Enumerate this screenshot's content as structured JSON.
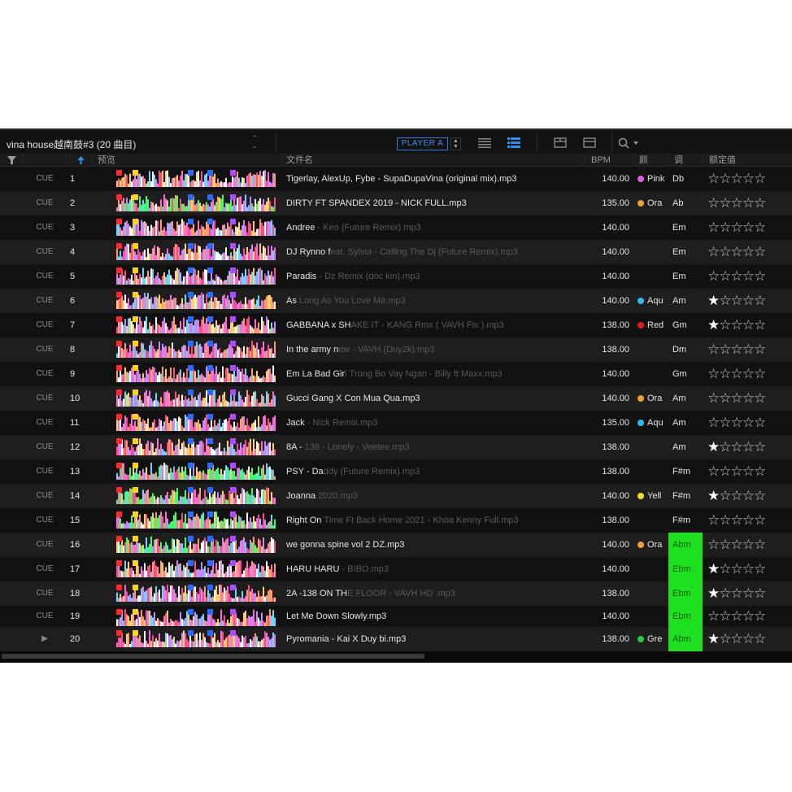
{
  "toolbar": {
    "playlist_title": "vina house越南鼓#3 (20 曲目)",
    "player_button": "PLAYER A"
  },
  "columns": {
    "preview": "预览",
    "filename": "文件名",
    "bpm": "BPM",
    "color": "颜",
    "key": "调",
    "rating": "额定值"
  },
  "cue_label": "CUE",
  "colors": {
    "Pink": "#e060e0",
    "Ora": "#f0a030",
    "Aqu": "#30b8f0",
    "Red": "#e02020",
    "Yell": "#f0e020",
    "Gre": "#20d040",
    "key_green": "#1ee01e",
    "accent_blue": "#2f7fe0"
  },
  "tracks": [
    {
      "num": "1",
      "name": "Tigerlay, AlexUp, Fybe - SupaDupaVina (original mix).mp3",
      "bpm": "140.00",
      "color": "Pink",
      "key": "Db",
      "key_green": false,
      "rating": 0
    },
    {
      "num": "2",
      "name": "DIRTY FT SPANDEX 2019 - NICK FULL.mp3",
      "bpm": "135.00",
      "color": "Ora",
      "key": "Ab",
      "key_green": false,
      "rating": 0
    },
    {
      "num": "3",
      "name": "Andree - Keo (Future Remix).mp3",
      "bpm": "140.00",
      "color": "",
      "key": "Em",
      "key_green": false,
      "rating": 0
    },
    {
      "num": "4",
      "name": "DJ Rynno feat. Sylvia - Calling The Dj (Future Remix).mp3",
      "bpm": "140.00",
      "color": "",
      "key": "Em",
      "key_green": false,
      "rating": 0
    },
    {
      "num": "5",
      "name": "Paradis - Dz Remix (doc kin).mp3",
      "bpm": "140.00",
      "color": "",
      "key": "Em",
      "key_green": false,
      "rating": 0
    },
    {
      "num": "6",
      "name": "As Long As You Love Me.mp3",
      "bpm": "140.00",
      "color": "Aqu",
      "key": "Am",
      "key_green": false,
      "rating": 1
    },
    {
      "num": "7",
      "name": "GABBANA x SHAKE IT - KANG Rmx ( VAVH Fix ).mp3",
      "bpm": "138.00",
      "color": "Red",
      "key": "Gm",
      "key_green": false,
      "rating": 1
    },
    {
      "num": "8",
      "name": "In the army now - VAVH (Duy2k).mp3",
      "bpm": "138.00",
      "color": "",
      "key": "Dm",
      "key_green": false,
      "rating": 0
    },
    {
      "num": "9",
      "name": "Em La Bad Girl Trong Bo Vay Ngan - Billy ft Maxx.mp3",
      "bpm": "140.00",
      "color": "",
      "key": "Gm",
      "key_green": false,
      "rating": 0
    },
    {
      "num": "10",
      "name": "Gucci Gang X Con Mua Qua.mp3",
      "bpm": "140.00",
      "color": "Ora",
      "key": "Am",
      "key_green": false,
      "rating": 0
    },
    {
      "num": "11",
      "name": "Jack - Nick Remix.mp3",
      "bpm": "135.00",
      "color": "Aqu",
      "key": "Am",
      "key_green": false,
      "rating": 0
    },
    {
      "num": "12",
      "name": "8A - 138 - Lonely - Veetee.mp3",
      "bpm": "138.00",
      "color": "",
      "key": "Am",
      "key_green": false,
      "rating": 1
    },
    {
      "num": "13",
      "name": "PSY - Daddy (Future Remix).mp3",
      "bpm": "138.00",
      "color": "",
      "key": "F#m",
      "key_green": false,
      "rating": 0
    },
    {
      "num": "14",
      "name": "Joanna 2020.mp3",
      "bpm": "140.00",
      "color": "Yell",
      "key": "F#m",
      "key_green": false,
      "rating": 1
    },
    {
      "num": "15",
      "name": "Right On Time Ft Back Home  2021 - Khoa Kenny Full.mp3",
      "bpm": "138.00",
      "color": "",
      "key": "F#m",
      "key_green": false,
      "rating": 0
    },
    {
      "num": "16",
      "name": "we gonna spine vol 2 DZ.mp3",
      "bpm": "140.00",
      "color": "Ora",
      "key": "Abm",
      "key_green": true,
      "rating": 0
    },
    {
      "num": "17",
      "name": "HARU HARU - BIBO.mp3",
      "bpm": "140.00",
      "color": "",
      "key": "Ebm",
      "key_green": true,
      "rating": 1
    },
    {
      "num": "18",
      "name": "2A -138 ON THE FLOOR - VAVH HD .mp3",
      "bpm": "138.00",
      "color": "",
      "key": "Ebm",
      "key_green": true,
      "rating": 1
    },
    {
      "num": "19",
      "name": "Let Me Down Slowly.mp3",
      "bpm": "140.00",
      "color": "",
      "key": "Ebm",
      "key_green": true,
      "rating": 0
    },
    {
      "num": "20",
      "name": "Pyromania - Kai X Duy bi.mp3",
      "bpm": "138.00",
      "color": "Gre",
      "key": "Abm",
      "key_green": true,
      "rating": 1,
      "playing": true
    }
  ]
}
